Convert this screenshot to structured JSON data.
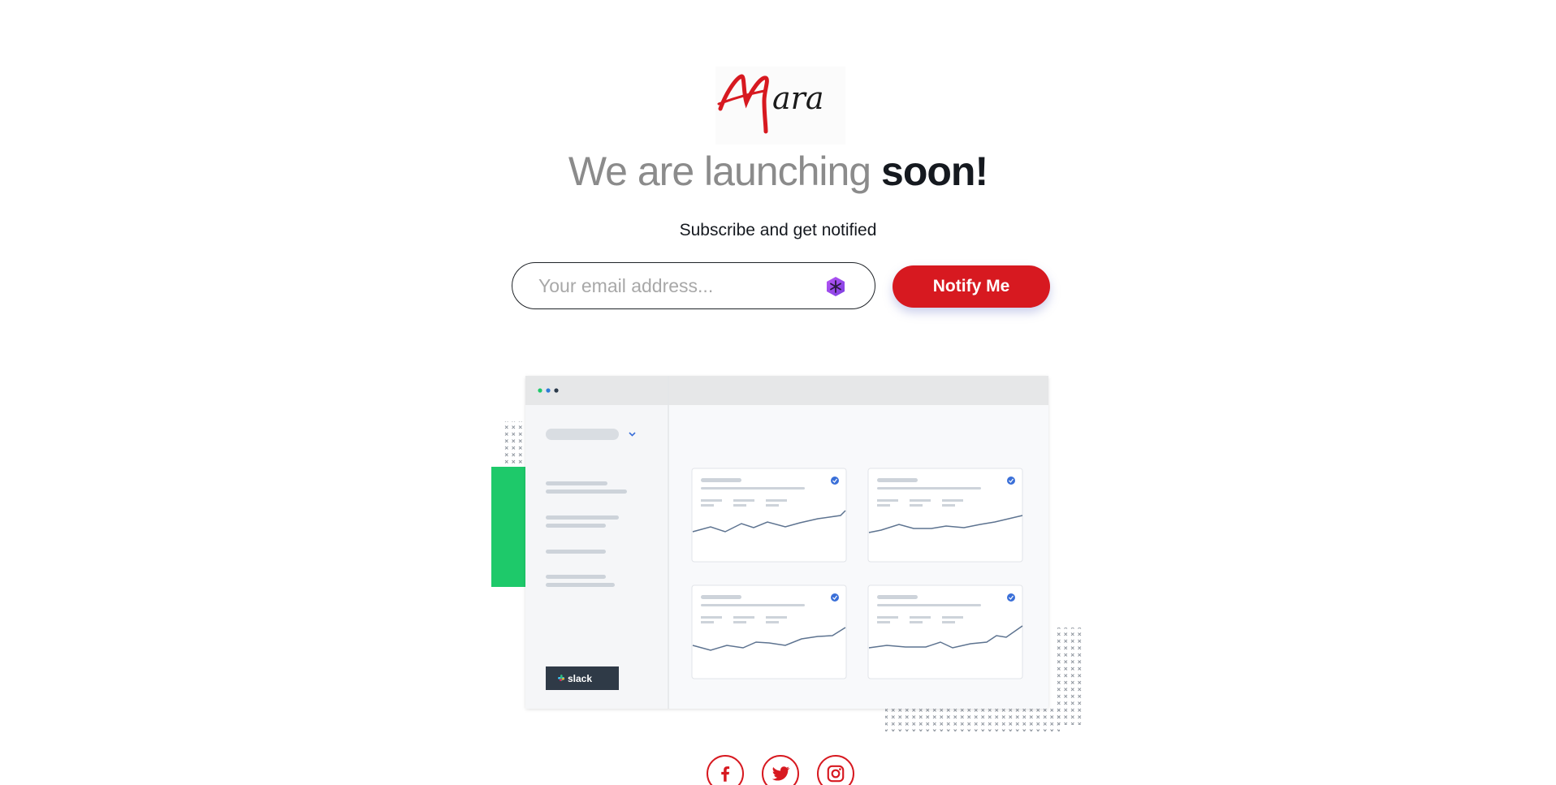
{
  "brand": {
    "logo_text": "Mara",
    "accent_color": "#d71920"
  },
  "headline": {
    "light": "We are launching",
    "bold": "soon!"
  },
  "subtitle": "Subscribe and get notified",
  "subscribe": {
    "email_placeholder": "Your email address...",
    "email_value": "",
    "button_label": "Notify Me",
    "field_icon": "extension-hexagon-icon"
  },
  "illustration": {
    "sidebar_button_label": "slack",
    "card_icons": [
      "check-circle-icon",
      "check-circle-icon",
      "check-circle-icon",
      "check-circle-icon"
    ]
  },
  "socials": [
    {
      "name": "facebook",
      "icon": "facebook-icon"
    },
    {
      "name": "twitter",
      "icon": "twitter-icon"
    },
    {
      "name": "instagram",
      "icon": "instagram-icon"
    }
  ]
}
